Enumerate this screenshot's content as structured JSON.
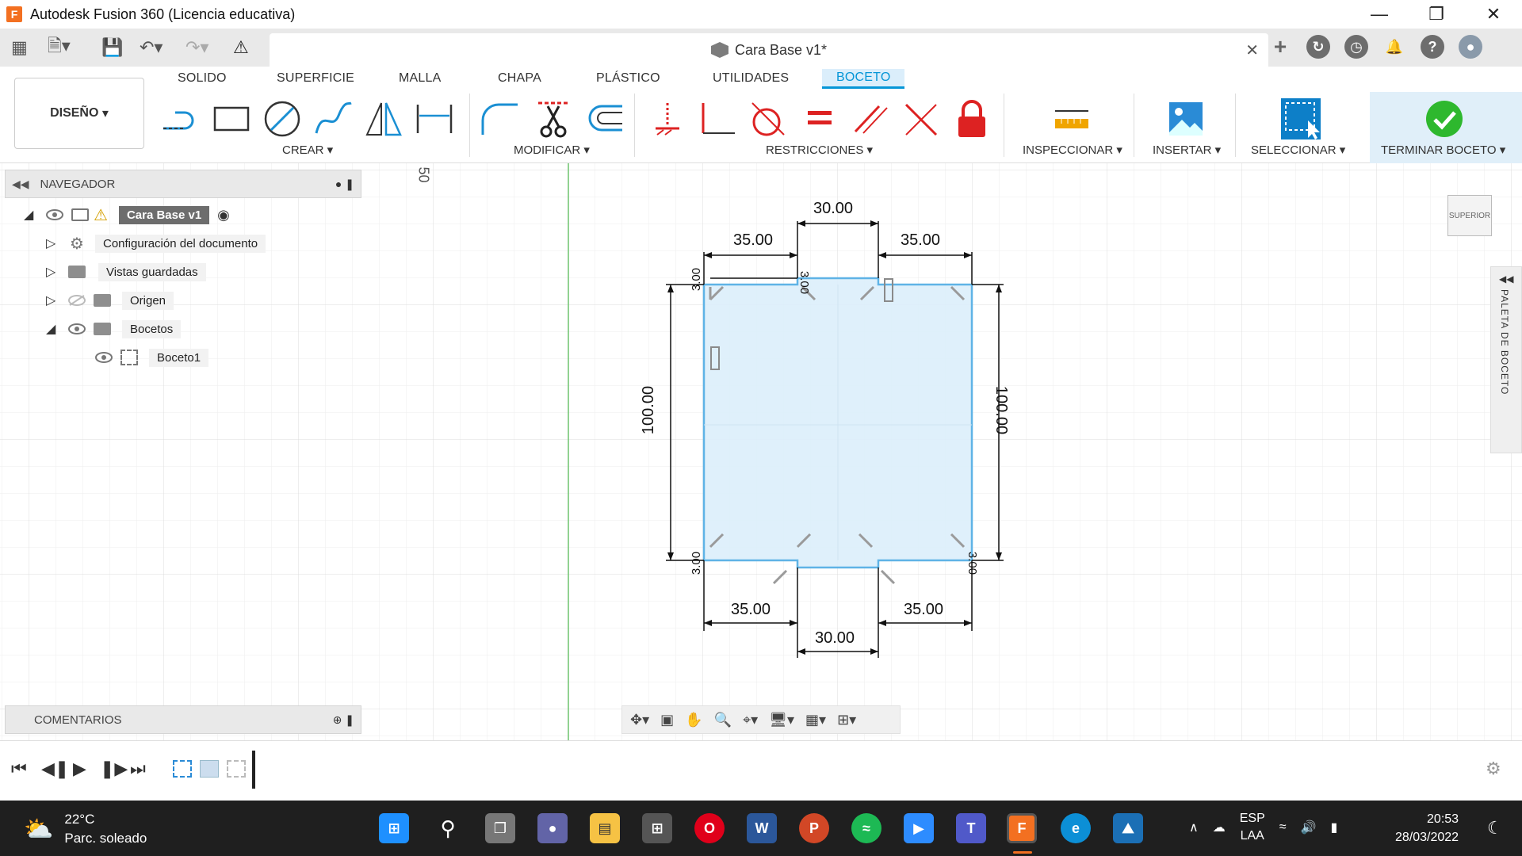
{
  "window": {
    "title": "Autodesk Fusion 360 (Licencia educativa)",
    "app_icon": "F",
    "controls": [
      "minimize-icon",
      "restore-icon",
      "close-icon"
    ]
  },
  "document_tab": {
    "title": "Cara Base v1*"
  },
  "ribbon": {
    "workspace": "DISEÑO",
    "tabs": [
      "SOLIDO",
      "SUPERFICIE",
      "MALLA",
      "CHAPA",
      "PLÁSTICO",
      "UTILIDADES",
      "BOCETO"
    ],
    "active_tab": "BOCETO",
    "groups": {
      "crear": "CREAR",
      "modificar": "MODIFICAR",
      "restricciones": "RESTRICCIONES",
      "inspeccionar": "INSPECCIONAR",
      "insertar": "INSERTAR",
      "seleccionar": "SELECCIONAR",
      "terminar": "TERMINAR BOCETO"
    },
    "accent_color": "#0696d7",
    "finish_color": "#2eb82e"
  },
  "navigator": {
    "title": "NAVEGADOR",
    "items": [
      {
        "label": "Cara Base v1"
      },
      {
        "label": "Configuración del documento"
      },
      {
        "label": "Vistas guardadas"
      },
      {
        "label": "Origen"
      },
      {
        "label": "Bocetos"
      },
      {
        "label": "Boceto1"
      }
    ]
  },
  "comments": {
    "title": "COMENTARIOS"
  },
  "viewcube": {
    "face": "SUPERIOR"
  },
  "palette": {
    "title": "PALETA DE BOCETO"
  },
  "canvas": {
    "ruler_label": "50",
    "dimensions": {
      "top_center": "30.00",
      "top_left": "35.00",
      "top_right": "35.00",
      "bottom_left": "35.00",
      "bottom_right": "35.00",
      "bottom_center": "30.00",
      "left_height": "100.00",
      "right_height": "100.00",
      "notch_top_left": "3.00",
      "notch_top_mid": "3.00",
      "notch_bottom_left": "3.00",
      "notch_bottom_right": "3.00"
    }
  },
  "taskbar": {
    "weather_temp": "22°C",
    "weather_desc": "Parc. soleado",
    "lang_top": "ESP",
    "lang_bottom": "LAA",
    "time": "20:53",
    "date": "28/03/2022"
  }
}
